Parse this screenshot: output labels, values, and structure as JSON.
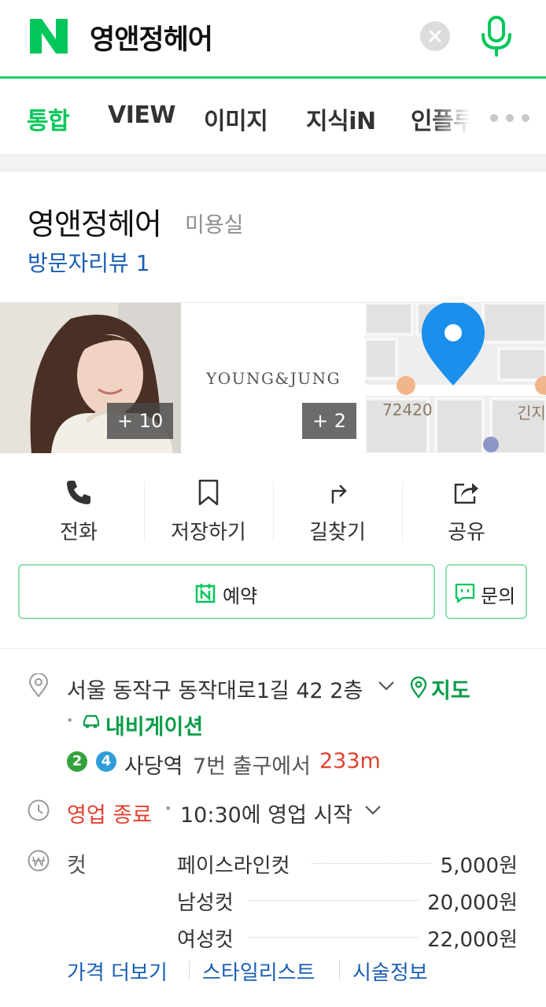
{
  "search": {
    "query": "영앤정헤어",
    "logo_icon": "naver-logo-icon",
    "clear_icon": "clear-x-icon",
    "mic_icon": "microphone-icon",
    "accent": "#03c75a"
  },
  "tabs": [
    {
      "label": "통합",
      "active": true
    },
    {
      "label": "VIEW",
      "active": false
    },
    {
      "label": "이미지",
      "active": false
    },
    {
      "label": "지식iN",
      "active": false
    },
    {
      "label": "인플루",
      "active": false
    }
  ],
  "place": {
    "name": "영앤정헤어",
    "category": "미용실",
    "review_link": "방문자리뷰 1"
  },
  "photos": {
    "photo1_count": "+ 10",
    "photo2_text": "YOUNG&JUNG",
    "photo2_count": "+ 2",
    "map_label_1": "72420",
    "map_label_2": "긴지"
  },
  "actions": {
    "call": "전화",
    "save": "저장하기",
    "directions": "길찾기",
    "share": "공유"
  },
  "buttons": {
    "reserve": "예약",
    "inquiry": "문의"
  },
  "info": {
    "address": "서울 동작구 동작대로1길 42 2층",
    "map_link": "지도",
    "navigation_link": "내비게이션",
    "subway_line_a": "2",
    "subway_line_b": "4",
    "station": "사당역",
    "exit_text": "7번 출구에서",
    "distance": "233m",
    "status": "영업 종료",
    "hours": "10:30에 영업 시작",
    "menu_category": "컷",
    "prices": [
      {
        "name": "페이스라인컷",
        "price": "5,000원"
      },
      {
        "name": "남성컷",
        "price": "20,000원"
      },
      {
        "name": "여성컷",
        "price": "22,000원"
      }
    ],
    "links": {
      "more_price": "가격 더보기",
      "stylist": "스타일리스트",
      "treatment": "시술정보"
    }
  }
}
